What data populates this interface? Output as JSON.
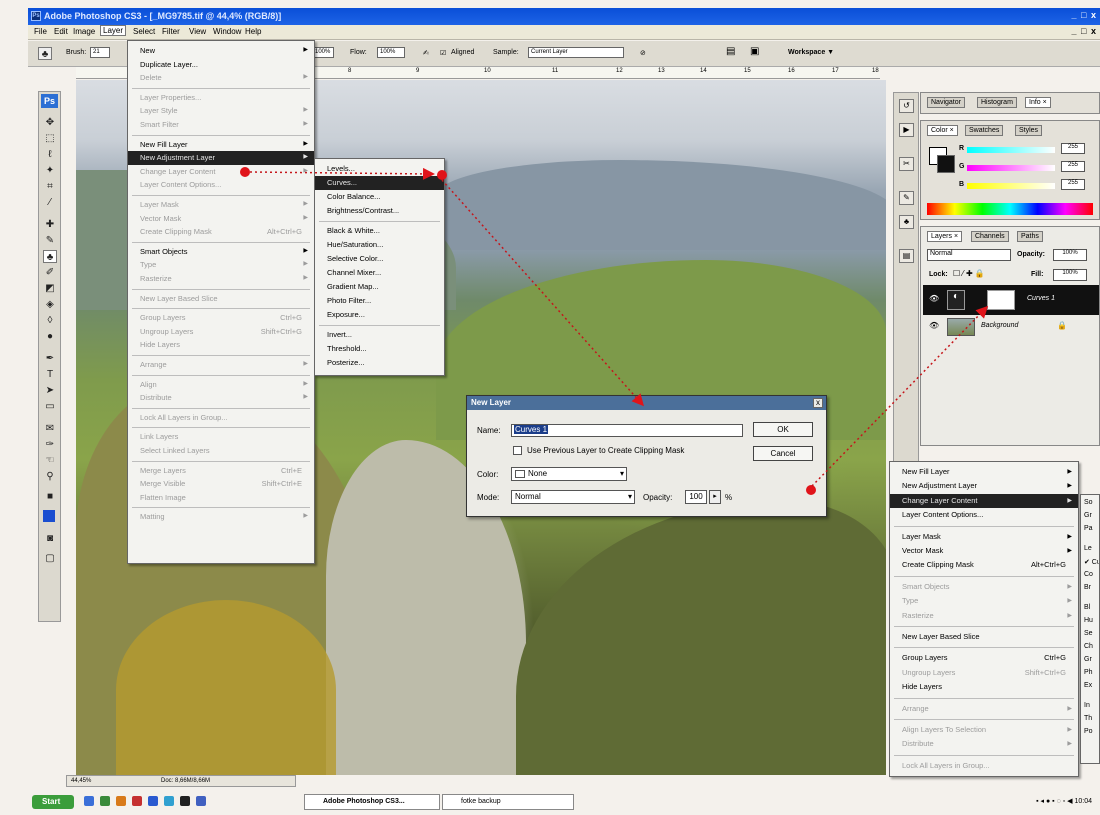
{
  "window": {
    "title": "Adobe Photoshop CS3 - [_MG9785.tif @ 44,4% (RGB/8)]",
    "controls": [
      "_",
      "□",
      "x"
    ]
  },
  "menubar": [
    "File",
    "Edit",
    "Image",
    "Layer",
    "Select",
    "Filter",
    "View",
    "Window",
    "Help"
  ],
  "options": {
    "brush_label": "Brush:",
    "brush_size": "21",
    "opacity_field": "100%",
    "flow_label": "Flow:",
    "flow_value": "100%",
    "aligned_label": "Aligned",
    "sample_label": "Sample:",
    "sample_value": "Current Layer",
    "workspace_label": "Workspace ▼"
  },
  "ruler_ticks": [
    "8",
    "9",
    "10",
    "11",
    "12",
    "13",
    "14",
    "15",
    "16",
    "17",
    "18"
  ],
  "layer_menu": [
    {
      "label": "New",
      "arrow": true
    },
    {
      "label": "Duplicate Layer..."
    },
    {
      "label": "Delete",
      "dis": true,
      "arrow": true
    },
    {
      "sep": true
    },
    {
      "label": "Layer Properties...",
      "dis": true
    },
    {
      "label": "Layer Style",
      "dis": true,
      "arrow": true
    },
    {
      "label": "Smart Filter",
      "dis": true,
      "arrow": true
    },
    {
      "sep": true
    },
    {
      "label": "New Fill Layer",
      "arrow": true
    },
    {
      "label": "New Adjustment Layer",
      "arrow": true,
      "hi": true
    },
    {
      "label": "Change Layer Content",
      "dis": true,
      "arrow": true
    },
    {
      "label": "Layer Content Options...",
      "dis": true
    },
    {
      "sep": true
    },
    {
      "label": "Layer Mask",
      "dis": true,
      "arrow": true
    },
    {
      "label": "Vector Mask",
      "dis": true,
      "arrow": true
    },
    {
      "label": "Create Clipping Mask",
      "dis": true,
      "shortcut": "Alt+Ctrl+G"
    },
    {
      "sep": true
    },
    {
      "label": "Smart Objects",
      "arrow": true
    },
    {
      "label": "Type",
      "dis": true,
      "arrow": true
    },
    {
      "label": "Rasterize",
      "dis": true,
      "arrow": true
    },
    {
      "sep": true
    },
    {
      "label": "New Layer Based Slice",
      "dis": true
    },
    {
      "sep": true
    },
    {
      "label": "Group Layers",
      "dis": true,
      "shortcut": "Ctrl+G"
    },
    {
      "label": "Ungroup Layers",
      "dis": true,
      "shortcut": "Shift+Ctrl+G"
    },
    {
      "label": "Hide Layers",
      "dis": true
    },
    {
      "sep": true
    },
    {
      "label": "Arrange",
      "dis": true,
      "arrow": true
    },
    {
      "sep": true
    },
    {
      "label": "Align",
      "dis": true,
      "arrow": true
    },
    {
      "label": "Distribute",
      "dis": true,
      "arrow": true
    },
    {
      "sep": true
    },
    {
      "label": "Lock All Layers in Group...",
      "dis": true
    },
    {
      "sep": true
    },
    {
      "label": "Link Layers",
      "dis": true
    },
    {
      "label": "Select Linked Layers",
      "dis": true
    },
    {
      "sep": true
    },
    {
      "label": "Merge Layers",
      "dis": true,
      "shortcut": "Ctrl+E"
    },
    {
      "label": "Merge Visible",
      "dis": true,
      "shortcut": "Shift+Ctrl+E"
    },
    {
      "label": "Flatten Image",
      "dis": true
    },
    {
      "sep": true
    },
    {
      "label": "Matting",
      "dis": true,
      "arrow": true
    }
  ],
  "adjust_submenu": [
    {
      "label": "Levels..."
    },
    {
      "label": "Curves...",
      "hi": true
    },
    {
      "label": "Color Balance..."
    },
    {
      "label": "Brightness/Contrast..."
    },
    {
      "sep": true
    },
    {
      "label": "Black & White..."
    },
    {
      "label": "Hue/Saturation..."
    },
    {
      "label": "Selective Color..."
    },
    {
      "label": "Channel Mixer..."
    },
    {
      "label": "Gradient Map..."
    },
    {
      "label": "Photo Filter..."
    },
    {
      "label": "Exposure..."
    },
    {
      "sep": true
    },
    {
      "label": "Invert..."
    },
    {
      "label": "Threshold..."
    },
    {
      "label": "Posterize..."
    }
  ],
  "context_menu": [
    {
      "label": "New Fill Layer",
      "arrow": true
    },
    {
      "label": "New Adjustment Layer",
      "arrow": true
    },
    {
      "label": "Change Layer Content",
      "arrow": true,
      "hi": true
    },
    {
      "label": "Layer Content Options..."
    },
    {
      "sep": true
    },
    {
      "label": "Layer Mask",
      "arrow": true
    },
    {
      "label": "Vector Mask",
      "arrow": true
    },
    {
      "label": "Create Clipping Mask",
      "shortcut": "Alt+Ctrl+G"
    },
    {
      "sep": true
    },
    {
      "label": "Smart Objects",
      "dis": true,
      "arrow": true
    },
    {
      "label": "Type",
      "dis": true,
      "arrow": true
    },
    {
      "label": "Rasterize",
      "dis": true,
      "arrow": true
    },
    {
      "sep": true
    },
    {
      "label": "New Layer Based Slice"
    },
    {
      "sep": true
    },
    {
      "label": "Group Layers",
      "shortcut": "Ctrl+G"
    },
    {
      "label": "Ungroup Layers",
      "dis": true,
      "shortcut": "Shift+Ctrl+G"
    },
    {
      "label": "Hide Layers"
    },
    {
      "sep": true
    },
    {
      "label": "Arrange",
      "dis": true,
      "arrow": true
    },
    {
      "sep": true
    },
    {
      "label": "Align Layers To Selection",
      "dis": true,
      "arrow": true
    },
    {
      "label": "Distribute",
      "dis": true,
      "arrow": true
    },
    {
      "sep": true
    },
    {
      "label": "Lock All Layers in Group...",
      "dis": true
    }
  ],
  "context_sub_clipped": [
    "So",
    "Gr",
    "Pa",
    "Le",
    "✔ Cu",
    "Co",
    "Br",
    "Bl",
    "Hu",
    "Se",
    "Ch",
    "Gr",
    "Ph",
    "Ex",
    "In",
    "Th",
    "Po"
  ],
  "navigator_panel": {
    "tabs": [
      "Navigator",
      "Histogram",
      "Info ×"
    ]
  },
  "color_panel": {
    "tabs": [
      "Color ×",
      "Swatches",
      "Styles"
    ],
    "channels": [
      {
        "name": "R",
        "value": "255"
      },
      {
        "name": "G",
        "value": "255"
      },
      {
        "name": "B",
        "value": "255"
      }
    ]
  },
  "layers_panel": {
    "tabs": [
      "Layers ×",
      "Channels",
      "Paths"
    ],
    "blend_mode": "Normal",
    "opacity_label": "Opacity:",
    "opacity_value": "100%",
    "lock_label": "Lock:",
    "fill_label": "Fill:",
    "fill_value": "100%",
    "layers": [
      {
        "name": "Curves 1",
        "selected": true
      },
      {
        "name": "Background",
        "selected": false
      }
    ]
  },
  "dialog": {
    "title": "New Layer",
    "name_label": "Name:",
    "name_value": "Curves 1",
    "clip_label": "Use Previous Layer to Create Clipping Mask",
    "color_label": "Color:",
    "color_value": "None",
    "mode_label": "Mode:",
    "mode_value": "Normal",
    "opacity_label": "Opacity:",
    "opacity_value": "100",
    "opacity_unit": "%",
    "ok": "OK",
    "cancel": "Cancel",
    "close": "x"
  },
  "statusbar": {
    "zoom": "44,45%",
    "doc": "Doc: 8,66M/8,66M"
  },
  "taskbar": {
    "start": "Start",
    "tasks": [
      "Adobe Photoshop CS3...",
      "fotke backup"
    ],
    "time": "10:04"
  },
  "colors": {
    "title_bar": "#1d63e6",
    "highlight": "#222222",
    "marker": "#e0141a"
  }
}
